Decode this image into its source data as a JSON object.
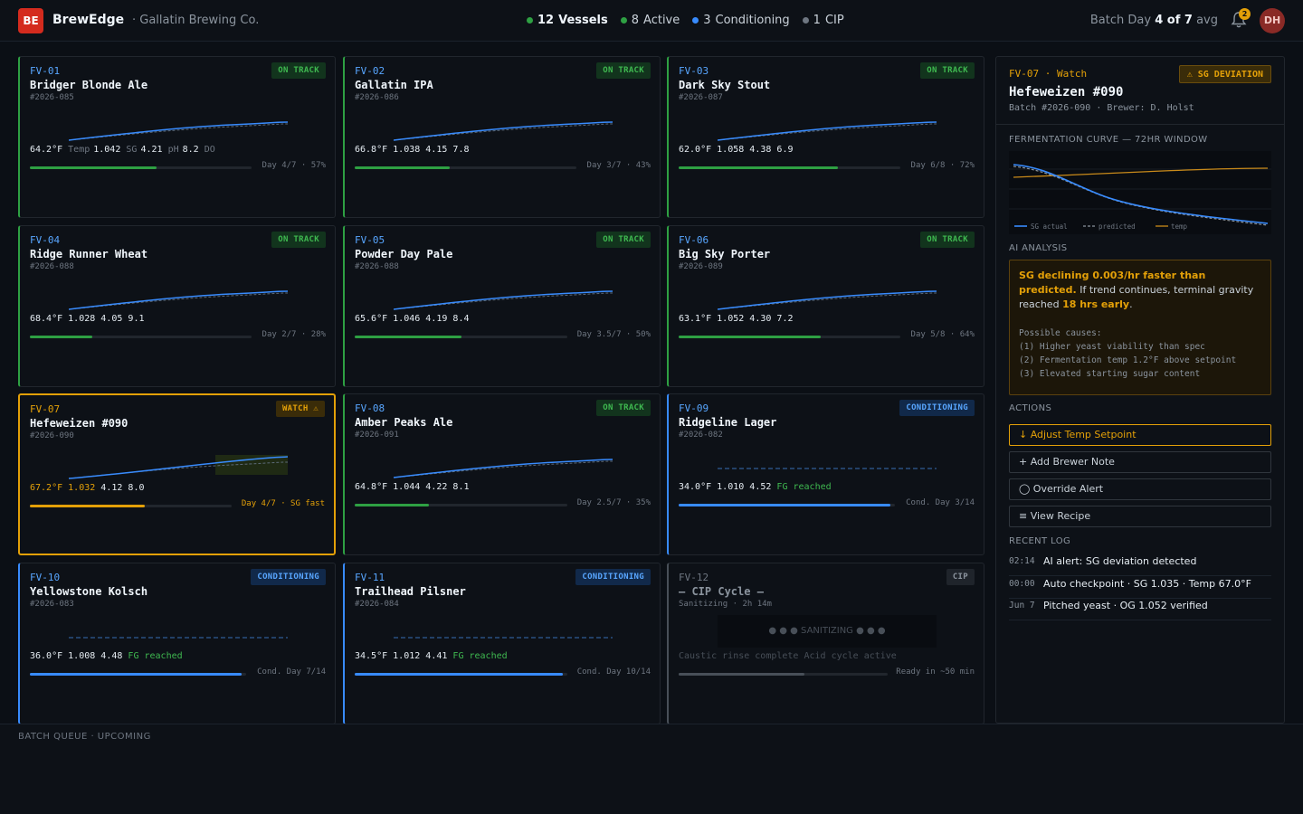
{
  "header": {
    "logo": "BE",
    "app_name": "BrewEdge",
    "brewery": "· Gallatin Brewing Co.",
    "stats": [
      {
        "count": "12",
        "label": "Vessels",
        "color": "#2ea043"
      },
      {
        "count": "8",
        "label": "Active",
        "color": "#2ea043"
      },
      {
        "count": "3",
        "label": "Conditioning",
        "color": "#388bfd"
      },
      {
        "count": "1",
        "label": "CIP",
        "color": "#6e7681"
      }
    ],
    "batch_day_prefix": "Batch Day",
    "batch_day_value": "4 of 7",
    "batch_day_suffix": "avg",
    "notification_count": "2",
    "avatar": "DH"
  },
  "vessels": [
    {
      "id": "FV-01",
      "name": "Bridger Blonde Ale",
      "batch": "#2026-085",
      "status": "ON TRACK",
      "temp": "64.2°F",
      "sg": "1.042",
      "ph": "4.21",
      "do": "8.2",
      "progress_text": "Day 4/7 · 57%",
      "progress": 0.57
    },
    {
      "id": "FV-02",
      "name": "Gallatin IPA",
      "batch": "#2026-086",
      "status": "ON TRACK",
      "temp": "66.8°F",
      "sg": "1.038",
      "ph": "4.15",
      "do": "7.8",
      "progress_text": "Day 3/7 · 43%",
      "progress": 0.43
    },
    {
      "id": "FV-03",
      "name": "Dark Sky Stout",
      "batch": "#2026-087",
      "status": "ON TRACK",
      "temp": "62.0°F",
      "sg": "1.058",
      "ph": "4.38",
      "do": "6.9",
      "progress_text": "Day 6/8 · 72%",
      "progress": 0.72
    },
    {
      "id": "FV-04",
      "name": "Ridge Runner Wheat",
      "batch": "#2026-088",
      "status": "ON TRACK",
      "temp": "68.4°F",
      "sg": "1.028",
      "ph": "4.05",
      "do": "9.1",
      "progress_text": "Day 2/7 · 28%",
      "progress": 0.28
    },
    {
      "id": "FV-05",
      "name": "Powder Day Pale",
      "batch": "#2026-088",
      "status": "ON TRACK",
      "temp": "65.6°F",
      "sg": "1.046",
      "ph": "4.19",
      "do": "8.4",
      "progress_text": "Day 3.5/7 · 50%",
      "progress": 0.5
    },
    {
      "id": "FV-06",
      "name": "Big Sky Porter",
      "batch": "#2026-089",
      "status": "ON TRACK",
      "temp": "63.1°F",
      "sg": "1.052",
      "ph": "4.30",
      "do": "7.2",
      "progress_text": "Day 5/8 · 64%",
      "progress": 0.64
    },
    {
      "id": "FV-07",
      "name": "Hefeweizen #090",
      "batch": "#2026-090",
      "status": "WATCH ⚠",
      "temp": "67.2°F",
      "sg": "1.032",
      "ph": "4.12",
      "do": "8.0",
      "progress_text": "Day 4/7 · SG fast",
      "progress": 0.57
    },
    {
      "id": "FV-08",
      "name": "Amber Peaks Ale",
      "batch": "#2026-091",
      "status": "ON TRACK",
      "temp": "64.8°F",
      "sg": "1.044",
      "ph": "4.22",
      "do": "8.1",
      "progress_text": "Day 2.5/7 · 35%",
      "progress": 0.35
    },
    {
      "id": "FV-09",
      "name": "Ridgeline Lager",
      "batch": "#2026-082",
      "status": "CONDITIONING",
      "temp": "34.0°F",
      "sg": "1.010",
      "ph": "4.52",
      "fg": "FG reached",
      "progress_text": "Cond. Day 3/14",
      "progress": 0.98
    },
    {
      "id": "FV-10",
      "name": "Yellowstone Kolsch",
      "batch": "#2026-083",
      "status": "CONDITIONING",
      "temp": "36.0°F",
      "sg": "1.008",
      "ph": "4.48",
      "fg": "FG reached",
      "progress_text": "Cond. Day 7/14",
      "progress": 0.98
    },
    {
      "id": "FV-11",
      "name": "Trailhead Pilsner",
      "batch": "#2026-084",
      "status": "CONDITIONING",
      "temp": "34.5°F",
      "sg": "1.012",
      "ph": "4.41",
      "fg": "FG reached",
      "progress_text": "Cond. Day 10/14",
      "progress": 0.98
    },
    {
      "id": "FV-12",
      "name": "— CIP Cycle —",
      "batch": "Sanitizing · 2h 14m",
      "status": "CIP",
      "cip_box": "● ● ● SANITIZING ● ● ●",
      "cip_note": "Caustic rinse complete  Acid cycle active",
      "progress_text": "Ready in ~50 min",
      "progress": 0.6
    }
  ],
  "value_units": {
    "temp": "Temp",
    "sg": "SG",
    "ph": "pH",
    "do": "DO"
  },
  "queue": {
    "title": "BATCH QUEUE · UPCOMING"
  },
  "panel": {
    "id_line": "FV-07 · Watch",
    "badge": "⚠ SG DEVIATION",
    "name": "Hefeweizen #090",
    "sub": "Batch #2026-090 · Brewer: D. Holst",
    "curve_title": "FERMENTATION CURVE — 72HR WINDOW",
    "legend": {
      "actual": "SG actual",
      "predicted": "predicted",
      "temp": "temp"
    },
    "ai_title": "AI ANALYSIS",
    "ai_highlight": "SG declining 0.003/hr faster than predicted.",
    "ai_text_1": " If trend continues, terminal gravity reached ",
    "ai_highlight_2": "18 hrs early",
    "ai_text_2": ".",
    "causes_title": "Possible causes:",
    "causes": [
      "(1) Higher yeast viability than spec",
      "(2) Fermentation temp 1.2°F above setpoint",
      "(3) Elevated starting sugar content"
    ],
    "actions_title": "ACTIONS",
    "actions": [
      "↓ Adjust Temp Setpoint",
      "+ Add Brewer Note",
      "◯ Override Alert",
      "≡ View Recipe"
    ],
    "log_title": "RECENT LOG",
    "log": [
      {
        "time": "02:14",
        "msg": "AI alert: SG deviation detected"
      },
      {
        "time": "00:00",
        "msg": "Auto checkpoint · SG 1.035 · Temp 67.0°F"
      },
      {
        "time": "Jun 7",
        "msg": "Pitched yeast · OG 1.052 verified"
      }
    ]
  },
  "colors": {
    "green": "#2ea043",
    "blue": "#388bfd",
    "amber": "#e3a008",
    "grey": "#484f58"
  }
}
